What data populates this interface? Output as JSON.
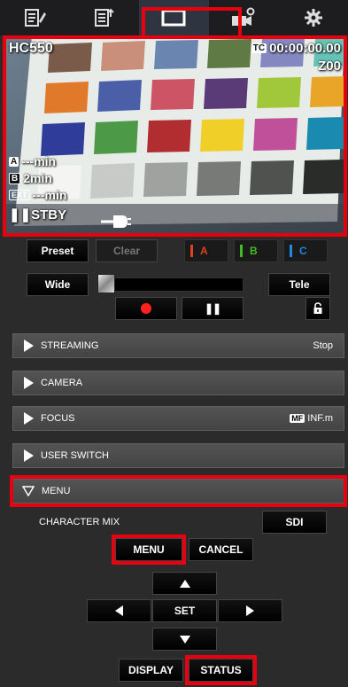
{
  "tabs": [
    {
      "name": "clip-list-tab",
      "icon": "clip-list-icon"
    },
    {
      "name": "playlist-tab",
      "icon": "playlist-icon"
    },
    {
      "name": "camera-remote-tab",
      "icon": "monitor-icon"
    },
    {
      "name": "camera-settings-tab",
      "icon": "camera-gear-icon"
    },
    {
      "name": "settings-tab",
      "icon": "gear-icon"
    }
  ],
  "preview": {
    "model": "HC550",
    "tc_tag": "TC",
    "timecode": "00:00:00.00",
    "zoom": "Z00",
    "slot_a_tag": "A",
    "slot_a": "---min",
    "slot_b_tag": "B",
    "slot_b": "2min",
    "ext_tag": "EXT",
    "ext": "---min",
    "status": "STBY"
  },
  "preset": {
    "preset_label": "Preset",
    "clear_label": "Clear",
    "slots": [
      {
        "label": "A",
        "color": "#e04020"
      },
      {
        "label": "B",
        "color": "#44bb22"
      },
      {
        "label": "C",
        "color": "#2288dd"
      }
    ]
  },
  "zoom": {
    "wide_label": "Wide",
    "tele_label": "Tele"
  },
  "sections": {
    "streaming": {
      "label": "STREAMING",
      "value": "Stop"
    },
    "camera": {
      "label": "CAMERA"
    },
    "focus": {
      "label": "FOCUS",
      "mf": "MF",
      "value": "INF.m"
    },
    "user_switch": {
      "label": "USER SWITCH"
    },
    "menu": {
      "label": "MENU"
    }
  },
  "menu_panel": {
    "character_mix_label": "CHARACTER MIX",
    "sdi_label": "SDI",
    "menu_label": "MENU",
    "cancel_label": "CANCEL",
    "set_label": "SET",
    "display_label": "DISPLAY",
    "status_label": "STATUS"
  },
  "colors": {
    "accent_red": "#e8000e",
    "record_red": "#ff2020"
  }
}
